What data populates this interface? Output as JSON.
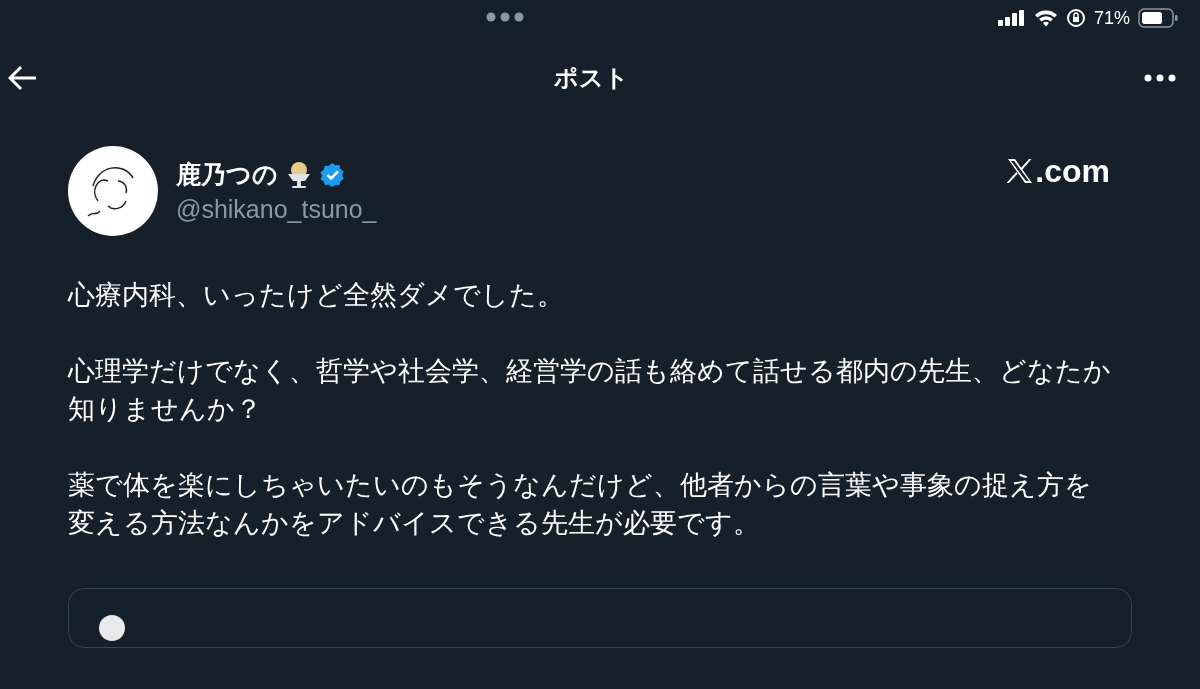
{
  "status_bar": {
    "battery_percent": "71%"
  },
  "header": {
    "title": "ポスト"
  },
  "author": {
    "name": "鹿乃つの",
    "handle": "@shikano_tsuno_",
    "verified": true
  },
  "brand": {
    "suffix": ".com"
  },
  "post": {
    "paragraphs": [
      "心療内科、いったけど全然ダメでした。",
      "心理学だけでなく、哲学や社会学、経営学の話も絡めて話せる都内の先生、どなたか知りませんか？",
      "薬で体を楽にしちゃいたいのもそうなんだけど、他者からの言葉や事象の捉え方を変える方法なんかをアドバイスできる先生が必要です。"
    ]
  }
}
